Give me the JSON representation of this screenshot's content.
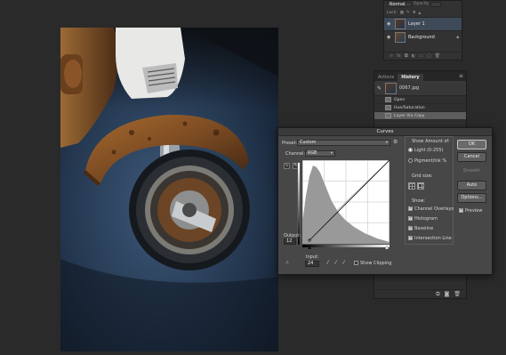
{
  "layers_panel": {
    "blend_mode": "Normal",
    "opacity_label": "Opacity",
    "lock_label": "Lock:",
    "layers": [
      {
        "name": "Layer 1",
        "selected": true
      },
      {
        "name": "Background",
        "selected": false
      }
    ]
  },
  "history_panel": {
    "tabs": [
      "Actions",
      "History"
    ],
    "active_tab": "History",
    "menu_icon": "≡",
    "snapshot_name": "0067.jpg",
    "steps": [
      {
        "label": "Open",
        "active": false
      },
      {
        "label": "Hue/Saturation",
        "active": false
      },
      {
        "label": "Layer Via Copy",
        "active": true
      }
    ]
  },
  "curves_dialog": {
    "title": "Curves",
    "preset_label": "Preset:",
    "preset_value": "Custom",
    "channel_label": "Channel:",
    "channel_value": "RGB",
    "output_label": "Output:",
    "output_value": "12",
    "input_label": "Input:",
    "input_value": "24",
    "show_clipping_label": "Show Clipping",
    "show_clipping_checked": false,
    "show_amount_label": "Show Amount of:",
    "light_label": "Light  (0-255)",
    "pigment_label": "Pigment/Ink %",
    "light_selected": true,
    "grid_size_label": "Grid size:",
    "show_label": "Show:",
    "show_options": [
      {
        "label": "Channel Overlays",
        "checked": true
      },
      {
        "label": "Histogram",
        "checked": true
      },
      {
        "label": "Baseline",
        "checked": true
      },
      {
        "label": "Intersection Line",
        "checked": true
      }
    ],
    "buttons": {
      "ok": "OK",
      "cancel": "Cancel",
      "smooth": "Smooth",
      "auto": "Auto",
      "options": "Options..."
    },
    "preview_label": "Preview",
    "preview_checked": true
  },
  "icons": {
    "eye": "eye-icon",
    "lock": "lock-icon",
    "gear": "gear-icon",
    "eyedropper": "eyedropper-icon",
    "trash": "trash-icon",
    "camera": "camera-icon",
    "new_doc": "new-document-icon"
  }
}
